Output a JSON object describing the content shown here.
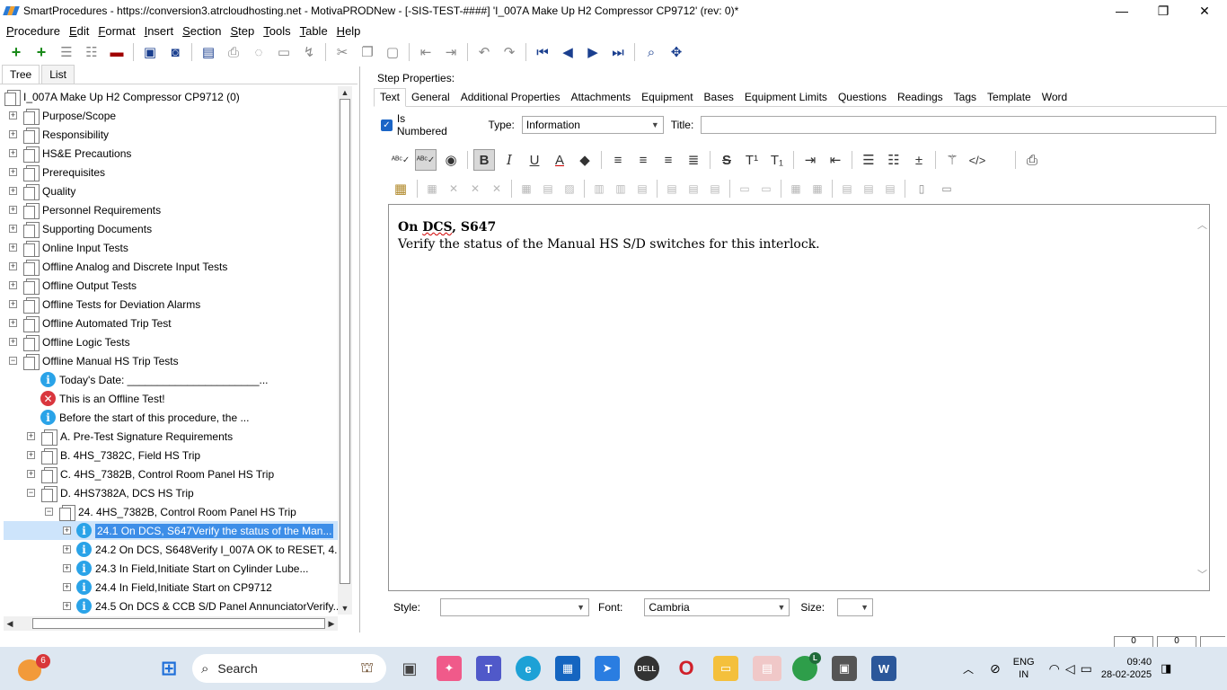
{
  "window": {
    "title": "SmartProcedures - https://conversion3.atrcloudhosting.net - MotivaPRODNew - [-SIS-TEST-####] 'I_007A Make Up H2 Compressor CP9712' (rev: 0)*",
    "minimize": "—",
    "maximize": "❐",
    "close": "✕"
  },
  "menu": [
    {
      "label": "Procedure"
    },
    {
      "label": "Edit"
    },
    {
      "label": "Format"
    },
    {
      "label": "Insert"
    },
    {
      "label": "Section"
    },
    {
      "label": "Step"
    },
    {
      "label": "Tools"
    },
    {
      "label": "Table"
    },
    {
      "label": "Help"
    }
  ],
  "left_tabs": [
    "Tree",
    "List"
  ],
  "tree": {
    "root": "I_007A Make Up H2 Compressor CP9712 (0)",
    "items": [
      {
        "label": "Purpose/Scope",
        "exp": "+",
        "indent": 0,
        "icon": "doc"
      },
      {
        "label": "Responsibility",
        "exp": "+",
        "indent": 0,
        "icon": "doc"
      },
      {
        "label": "HS&E Precautions",
        "exp": "+",
        "indent": 0,
        "icon": "doc"
      },
      {
        "label": "Prerequisites",
        "exp": "+",
        "indent": 0,
        "icon": "doc"
      },
      {
        "label": "Quality",
        "exp": "+",
        "indent": 0,
        "icon": "doc"
      },
      {
        "label": "Personnel Requirements",
        "exp": "+",
        "indent": 0,
        "icon": "doc"
      },
      {
        "label": "Supporting Documents",
        "exp": "+",
        "indent": 0,
        "icon": "doc"
      },
      {
        "label": "Online Input Tests",
        "exp": "+",
        "indent": 0,
        "icon": "doc"
      },
      {
        "label": "Offline Analog and Discrete Input Tests",
        "exp": "+",
        "indent": 0,
        "icon": "doc"
      },
      {
        "label": "Offline Output Tests",
        "exp": "+",
        "indent": 0,
        "icon": "doc"
      },
      {
        "label": "Offline Tests for Deviation Alarms",
        "exp": "+",
        "indent": 0,
        "icon": "doc"
      },
      {
        "label": "Offline Automated Trip Test",
        "exp": "+",
        "indent": 0,
        "icon": "doc"
      },
      {
        "label": "Offline Logic Tests",
        "exp": "+",
        "indent": 0,
        "icon": "doc"
      },
      {
        "label": "Offline Manual HS Trip Tests",
        "exp": "−",
        "indent": 0,
        "icon": "doc"
      },
      {
        "label": "Today's Date: ______________________...",
        "exp": "",
        "indent": 1,
        "icon": "info"
      },
      {
        "label": "This is an Offline Test!",
        "exp": "",
        "indent": 1,
        "icon": "err"
      },
      {
        "label": "Before the start of this procedure, the ...",
        "exp": "",
        "indent": 1,
        "icon": "info"
      },
      {
        "label": "A. Pre-Test Signature Requirements",
        "exp": "+",
        "indent": 1,
        "icon": "doc"
      },
      {
        "label": "B. 4HS_7382C, Field HS Trip",
        "exp": "+",
        "indent": 1,
        "icon": "doc"
      },
      {
        "label": "C. 4HS_7382B, Control Room Panel HS Trip",
        "exp": "+",
        "indent": 1,
        "icon": "doc"
      },
      {
        "label": "D. 4HS7382A, DCS HS Trip",
        "exp": "−",
        "indent": 1,
        "icon": "doc"
      },
      {
        "label": "24. 4HS_7382B, Control Room Panel HS Trip",
        "exp": "−",
        "indent": 2,
        "icon": "doc"
      },
      {
        "label": "24.1 On DCS, S647Verify the status of the Man...",
        "exp": "+",
        "indent": 3,
        "icon": "info",
        "selected": true
      },
      {
        "label": "24.2 On DCS, S648Verify I_007A OK to RESET, 4...",
        "exp": "+",
        "indent": 3,
        "icon": "info"
      },
      {
        "label": "24.3 In Field,Initiate Start on Cylinder Lube...",
        "exp": "+",
        "indent": 3,
        "icon": "info"
      },
      {
        "label": "24.4 In Field,Initiate Start on CP9712",
        "exp": "+",
        "indent": 3,
        "icon": "info"
      },
      {
        "label": "24.5 On DCS & CCB S/D Panel AnnunciatorVerify...",
        "exp": "+",
        "indent": 3,
        "icon": "info"
      }
    ]
  },
  "step_properties": {
    "label": "Step Properties:",
    "tabs": [
      "Text",
      "General",
      "Additional Properties",
      "Attachments",
      "Equipment",
      "Bases",
      "Equipment Limits",
      "Questions",
      "Readings",
      "Tags",
      "Template",
      "Word"
    ],
    "is_numbered_label": "Is Numbered",
    "type_label": "Type:",
    "type_value": "Information",
    "title_label": "Title:",
    "title_value": ""
  },
  "editor": {
    "title_prefix": "On ",
    "title_squiggle": "DCS",
    "title_suffix": ", S647",
    "body": "Verify the status of the Manual HS S/D switches for this interlock."
  },
  "bottom": {
    "style_label": "Style:",
    "style_value": "",
    "font_label": "Font:",
    "font_value": "Cambria",
    "size_label": "Size:",
    "size_value": ""
  },
  "status": {
    "box1": "0",
    "box2": "0"
  },
  "taskbar": {
    "weather_badge": "6",
    "search_label": "Search",
    "lang_top": "ENG",
    "lang_bottom": "IN",
    "time": "09:40",
    "date": "28-02-2025",
    "chrome_badge": "L"
  }
}
